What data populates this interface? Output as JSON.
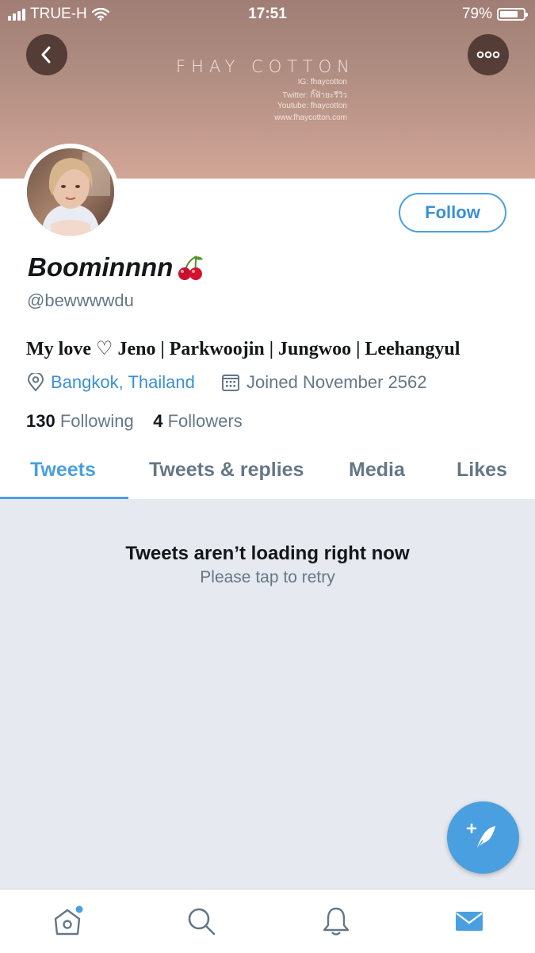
{
  "status_bar": {
    "carrier": "TRUE-H",
    "time": "17:51",
    "battery": "79%",
    "battery_level": 0.79
  },
  "banner": {
    "brand": "FHAY COTTON",
    "lines": [
      "IG: fhaycotton",
      "Twitter: กิ๊ฟ้ายะรีวิว",
      "Youtube: fhaycotton",
      "www.fhaycotton.com"
    ]
  },
  "profile": {
    "name": "Boominnnn",
    "name_emoji": "cherries-icon",
    "handle": "@bewwwwdu",
    "bio": "My love ♡ Jeno | Parkwoojin | Jungwoo | Leehangyul",
    "location": "Bangkok, Thailand",
    "joined": "Joined November 2562",
    "following_count": "130",
    "following_label": "Following",
    "followers_count": "4",
    "followers_label": "Followers",
    "follow_button": "Follow"
  },
  "tabs": [
    {
      "label": "Tweets",
      "active": true
    },
    {
      "label": "Tweets & replies",
      "active": false
    },
    {
      "label": "Media",
      "active": false
    },
    {
      "label": "Likes",
      "active": false
    }
  ],
  "error": {
    "title": "Tweets aren’t loading right now",
    "subtitle": "Please tap to retry"
  },
  "bottom_nav": [
    "home-icon",
    "search-icon",
    "bell-icon",
    "mail-icon"
  ],
  "colors": {
    "accent": "#4a9fe0",
    "header_top": "#a07e75",
    "header_bottom": "#d2a697",
    "muted": "#657786",
    "content_bg": "#e6e9ef"
  }
}
